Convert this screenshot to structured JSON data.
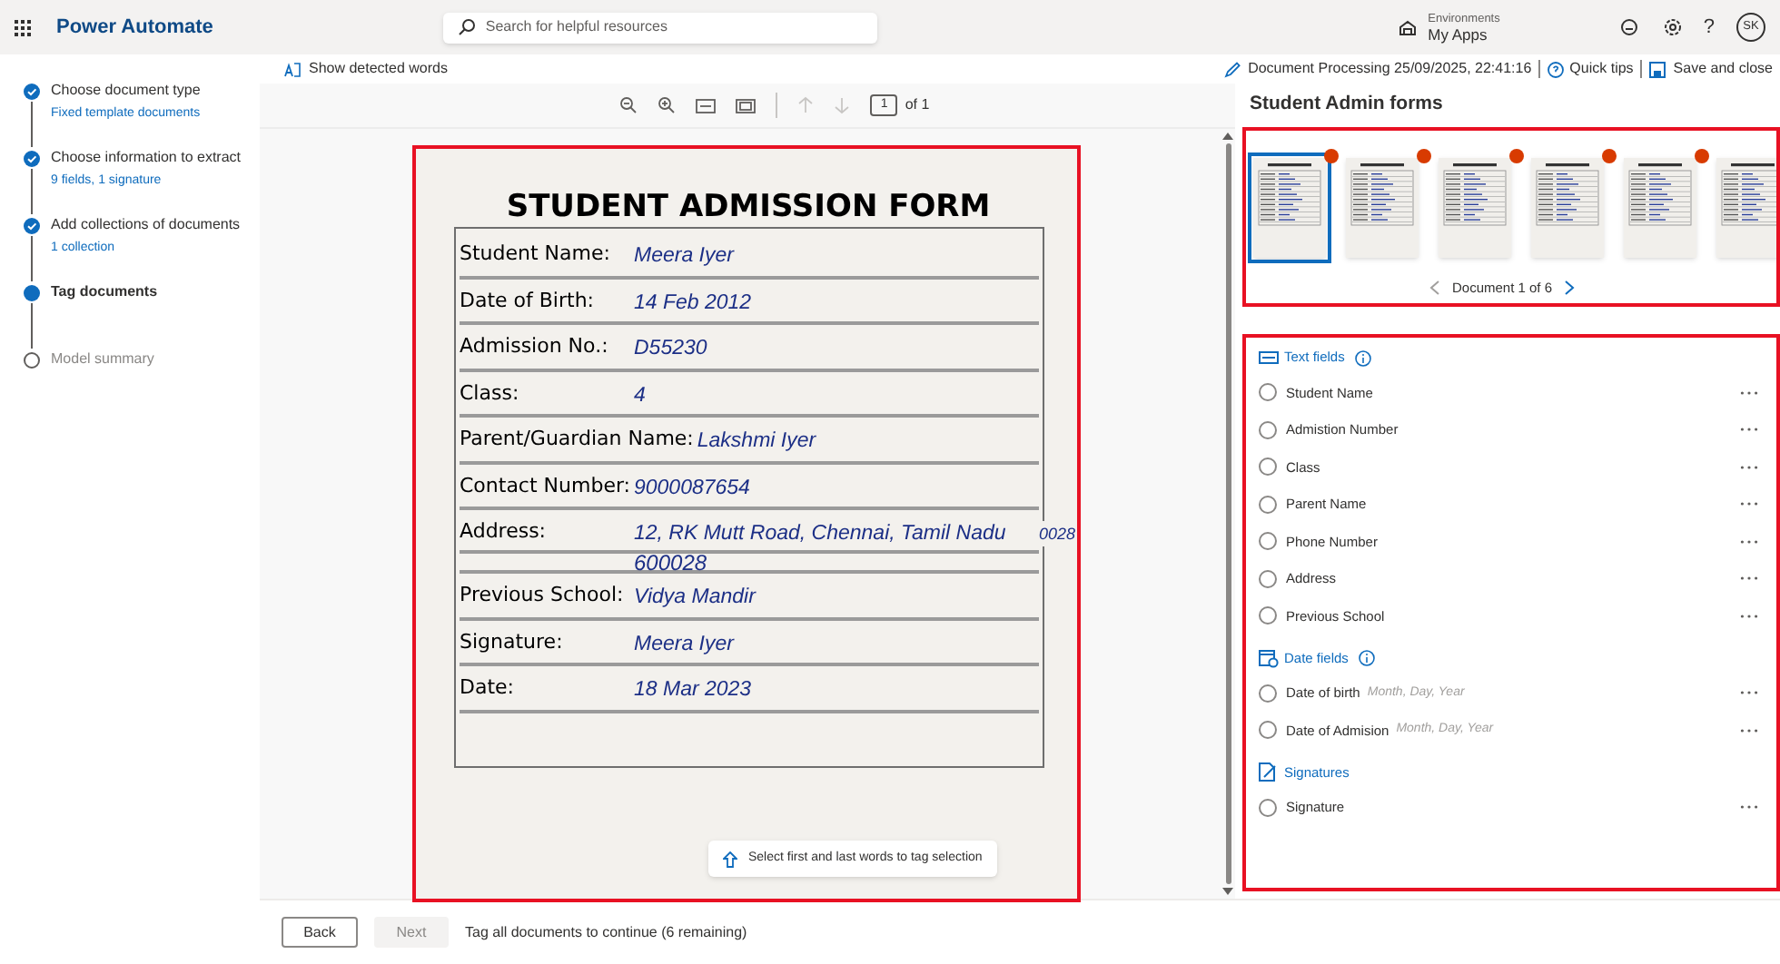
{
  "app": {
    "title": "Power Automate",
    "search_placeholder": "Search for helpful resources",
    "environment_label": "Environments",
    "environment": "My Apps",
    "avatar": "SK",
    "help": "?"
  },
  "steps": [
    {
      "title": "Choose document type",
      "subtitle": "Fixed template documents",
      "done": true,
      "current": false
    },
    {
      "title": "Choose information to extract",
      "subtitle": "9 fields, 1 signature",
      "done": true,
      "current": false
    },
    {
      "title": "Add collections of documents",
      "subtitle": "1 collection",
      "done": true,
      "current": false
    },
    {
      "title": "Tag documents",
      "done": false,
      "current": true
    },
    {
      "title": "Model summary",
      "done": false,
      "current": false
    }
  ],
  "command_bar": {
    "show_words": "Show detected words",
    "document": "Document Processing 25/09/2025, 22:41:16",
    "quick_tips": "Quick tips",
    "save": "Save and close"
  },
  "viewer": {
    "page": "1",
    "page_total": "of 1",
    "hint": "Select first and last words to tag selection"
  },
  "form": {
    "title": "STUDENT ADMISSION FORM",
    "rows": [
      {
        "label": "Student Name:",
        "value": "Meera Iyer"
      },
      {
        "label": "Date of Birth:",
        "value": "14 Feb 2012"
      },
      {
        "label": "Admission No.:",
        "value": "D55230"
      },
      {
        "label": "Class:",
        "value": "4"
      },
      {
        "label": "Parent/Guardian Name:",
        "value": "Lakshmi Iyer"
      },
      {
        "label": "Contact Number:",
        "value": "9000087654"
      },
      {
        "label": "Address:",
        "value": "12, RK Mutt Road, Chennai, Tamil Nadu",
        "continuation": "600028",
        "overflow": "0028"
      },
      {
        "label": "Previous School:",
        "value": "Vidya Mandir"
      },
      {
        "label": "Signature:",
        "value": "Meera Iyer"
      },
      {
        "label": "Date:",
        "value": "18 Mar 2023"
      }
    ]
  },
  "collection": {
    "title": "Student Admin forms",
    "thumbnails": [
      {
        "selected": true
      },
      {
        "selected": false
      },
      {
        "selected": false
      },
      {
        "selected": false
      },
      {
        "selected": false
      },
      {
        "selected": false
      }
    ],
    "pager": "Document 1 of 6"
  },
  "field_groups": [
    {
      "kind": "text",
      "title": "Text fields",
      "info": true,
      "fields": [
        {
          "name": "Student Name",
          "selected": false
        },
        {
          "name": "Admistion Number",
          "selected": false
        },
        {
          "name": "Class",
          "selected": false
        },
        {
          "name": "Parent Name",
          "selected": false
        },
        {
          "name": "Phone Number",
          "selected": false
        },
        {
          "name": "Address",
          "selected": false
        },
        {
          "name": "Previous School",
          "selected": false
        }
      ]
    },
    {
      "kind": "date",
      "title": "Date fields",
      "info": true,
      "fields": [
        {
          "name": "Date of birth",
          "format": "Month, Day, Year",
          "selected": false
        },
        {
          "name": "Date of Admision",
          "format": "Month, Day, Year",
          "selected": false
        }
      ]
    },
    {
      "kind": "signature",
      "title": "Signatures",
      "info": false,
      "fields": [
        {
          "name": "Signature",
          "selected": false
        }
      ]
    }
  ],
  "footer": {
    "back": "Back",
    "next": "Next",
    "next_disabled": true,
    "status": "Tag all documents to continue (6 remaining)"
  }
}
